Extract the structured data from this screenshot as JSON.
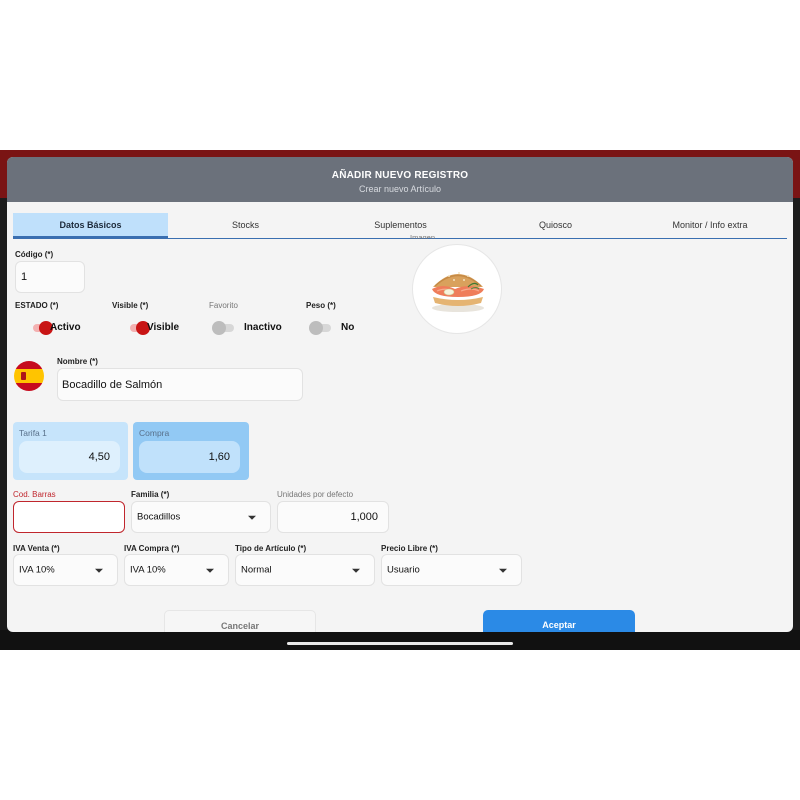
{
  "modal": {
    "title": "AÑADIR NUEVO REGISTRO",
    "subtitle": "Crear nuevo Artículo"
  },
  "tabs": [
    {
      "label": "Datos Básicos",
      "active": true
    },
    {
      "label": "Stocks",
      "active": false
    },
    {
      "label": "Suplementos",
      "active": false
    },
    {
      "label": "Quiosco",
      "active": false
    },
    {
      "label": "Monitor / Info extra",
      "active": false
    }
  ],
  "form": {
    "codigo": {
      "label": "Código (*)",
      "value": "1"
    },
    "imagen": {
      "label": "Imagen",
      "icon": "sandwich-image"
    },
    "toggles": [
      {
        "label": "ESTADO (*)",
        "state_label": "Activo",
        "on": true
      },
      {
        "label": "Visible (*)",
        "state_label": "Visible",
        "on": true
      },
      {
        "label": "Favorito",
        "state_label": "Inactivo",
        "on": false
      },
      {
        "label": "Peso (*)",
        "state_label": "No",
        "on": false
      }
    ],
    "nombre": {
      "label": "Nombre (*)",
      "value": "Bocadillo de Salmón",
      "flag_icon": "spain-flag-icon"
    },
    "tarifa": {
      "label": "Tarifa 1",
      "value": "4,50"
    },
    "compra": {
      "label": "Compra",
      "value": "1,60"
    },
    "cod_barras": {
      "label": "Cod. Barras",
      "value": ""
    },
    "familia": {
      "label": "Familia (*)",
      "value": "Bocadillos"
    },
    "unidades": {
      "label": "Unidades por defecto",
      "value": "1,000"
    },
    "iva_venta": {
      "label": "IVA Venta (*)",
      "value": "IVA 10%"
    },
    "iva_compra": {
      "label": "IVA Compra (*)",
      "value": "IVA 10%"
    },
    "tipo_articulo": {
      "label": "Tipo de Artículo (*)",
      "value": "Normal"
    },
    "precio_libre": {
      "label": "Precio Libre (*)",
      "value": "Usuario"
    }
  },
  "buttons": {
    "cancel": "Cancelar",
    "accept": "Aceptar"
  },
  "colors": {
    "header": "#6b717b",
    "tab_active": "#bfe0fb",
    "toggle_on": "#c81414",
    "accept": "#2b8ae6",
    "error": "#c0262d",
    "app_bar": "#7a1414"
  }
}
